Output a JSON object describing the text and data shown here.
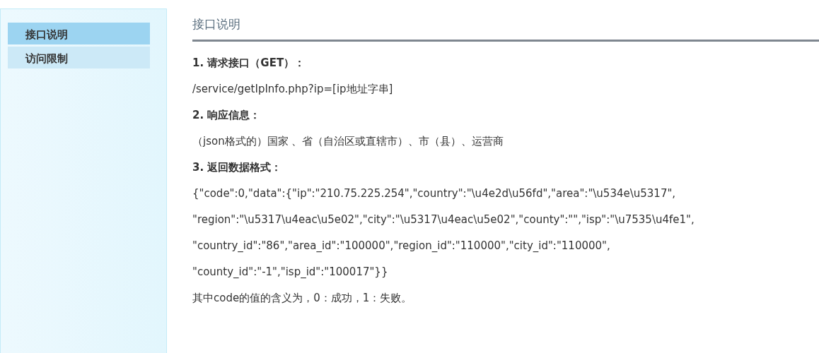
{
  "sidebar": {
    "items": [
      {
        "label": "接口说明",
        "selected": true
      },
      {
        "label": "访问限制",
        "selected": false
      }
    ]
  },
  "content": {
    "title": "接口说明",
    "lines": [
      {
        "kind": "heading",
        "text": "1. 请求接口（GET）："
      },
      {
        "kind": "text",
        "text": "/service/getIpInfo.php?ip=[ip地址字串]"
      },
      {
        "kind": "heading",
        "text": "2. 响应信息："
      },
      {
        "kind": "text",
        "text": "（json格式的）国家 、省（自治区或直辖市）、市（县）、运营商"
      },
      {
        "kind": "heading",
        "text": "3. 返回数据格式："
      },
      {
        "kind": "text",
        "text": "{\"code\":0,\"data\":{\"ip\":\"210.75.225.254\",\"country\":\"\\u4e2d\\u56fd\",\"area\":\"\\u534e\\u5317\","
      },
      {
        "kind": "text",
        "text": "\"region\":\"\\u5317\\u4eac\\u5e02\",\"city\":\"\\u5317\\u4eac\\u5e02\",\"county\":\"\",\"isp\":\"\\u7535\\u4fe1\","
      },
      {
        "kind": "text",
        "text": "\"country_id\":\"86\",\"area_id\":\"100000\",\"region_id\":\"110000\",\"city_id\":\"110000\","
      },
      {
        "kind": "text",
        "text": "\"county_id\":\"-1\",\"isp_id\":\"100017\"}}"
      },
      {
        "kind": "note",
        "text": "其中code的值的含义为，0：成功，1：失败。"
      }
    ]
  }
}
